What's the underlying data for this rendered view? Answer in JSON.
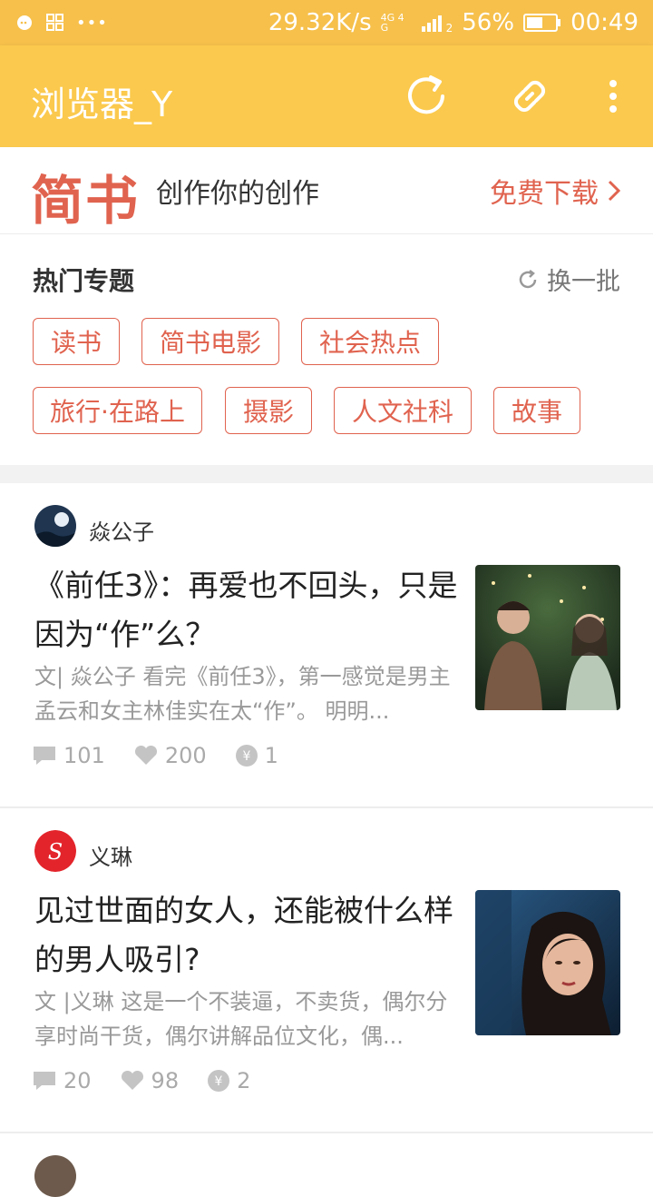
{
  "status_bar": {
    "speed": "29.32K/s",
    "network": "4G 4G",
    "signal_index": "2",
    "battery": "56%",
    "time": "00:49"
  },
  "app_bar": {
    "title": "浏览器_Y",
    "icons": [
      "refresh-icon",
      "link-icon",
      "more-vert-icon"
    ]
  },
  "banner": {
    "logo": "简书",
    "slogan": "创作你的创作",
    "download": "免费下载"
  },
  "hot_topics": {
    "title": "热门专题",
    "refresh_label": "换一批",
    "tags": [
      "读书",
      "简书电影",
      "社会热点",
      "旅行·在路上",
      "摄影",
      "人文社科",
      "故事"
    ]
  },
  "articles": [
    {
      "author": "焱公子",
      "title": "《前任3》：再爱也不回头，只是因为“作”么？",
      "excerpt": "文| 焱公子 看完《前任3》，第一感觉是男主孟云和女主林佳实在太“作”。 明明...",
      "comments": "101",
      "likes": "200",
      "rewards": "1"
    },
    {
      "author": "义琳",
      "title": "见过世面的女人，还能被什么样的男人吸引?",
      "excerpt": "文 |义琳 这是一个不装逼，不卖货，偶尔分享时尚干货，偶尔讲解品位文化，偶...",
      "comments": "20",
      "likes": "98",
      "rewards": "2"
    }
  ],
  "colors": {
    "status_bar": "#f6c04b",
    "app_bar": "#fbc94d",
    "accent": "#e0634f"
  }
}
